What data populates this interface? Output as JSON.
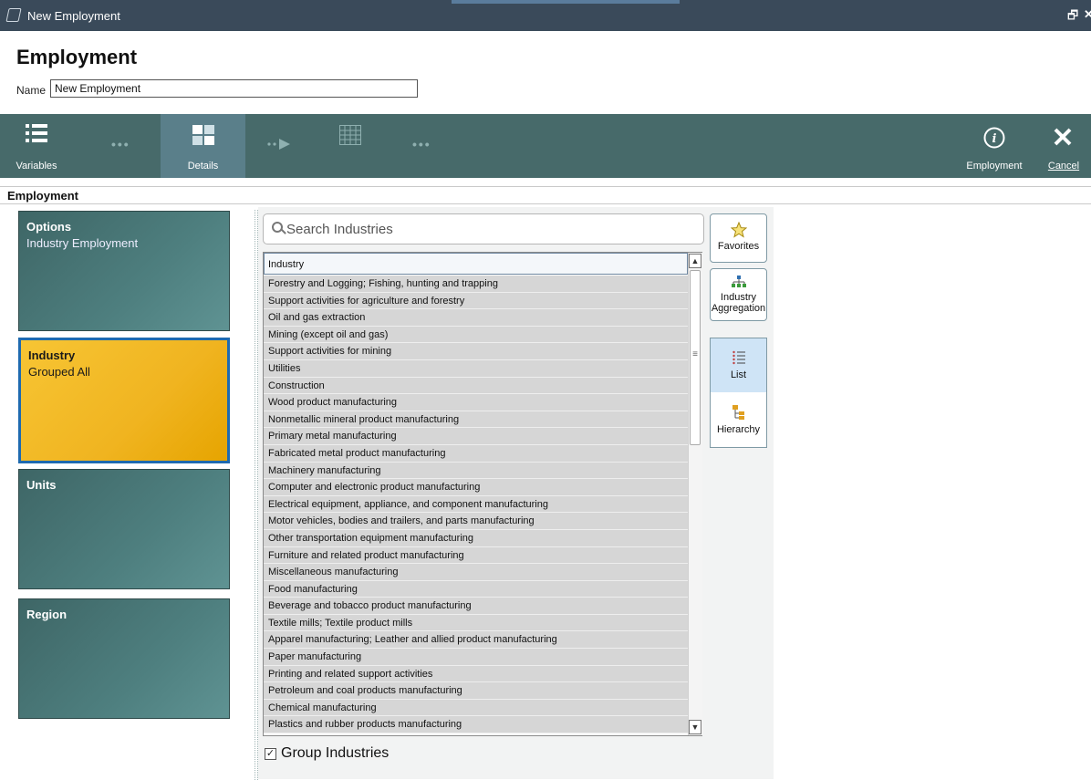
{
  "window": {
    "title": "New Employment",
    "restore_glyph": "🗗",
    "close_glyph": "✕"
  },
  "header": {
    "title": "Employment",
    "name_label": "Name",
    "name_value": "New Employment"
  },
  "toolbar": {
    "variables_label": "Variables",
    "details_label": "Details",
    "employment_label": "Employment",
    "cancel_label": "Cancel",
    "dots": "•••"
  },
  "section": {
    "title": "Employment"
  },
  "cards": [
    {
      "title": "Options",
      "subtitle": "Industry Employment"
    },
    {
      "title": "Industry",
      "subtitle": "Grouped All"
    },
    {
      "title": "Units",
      "subtitle": ""
    },
    {
      "title": "Region",
      "subtitle": ""
    }
  ],
  "search": {
    "placeholder": "Search Industries"
  },
  "list": {
    "header": "Industry",
    "scroll_grip": "≡",
    "scroll_up": "▲",
    "scroll_down": "▼",
    "rows": [
      "Forestry and Logging; Fishing, hunting and trapping",
      "Support activities for agriculture and forestry",
      "Oil and gas extraction",
      "Mining (except oil and gas)",
      "Support activities for mining",
      "Utilities",
      "Construction",
      "Wood product manufacturing",
      "Nonmetallic mineral product manufacturing",
      "Primary metal manufacturing",
      "Fabricated metal product manufacturing",
      "Machinery manufacturing",
      "Computer and electronic product manufacturing",
      "Electrical equipment, appliance, and component manufacturing",
      "Motor vehicles, bodies and trailers, and parts manufacturing",
      "Other transportation equipment manufacturing",
      "Furniture and related product manufacturing",
      "Miscellaneous manufacturing",
      "Food manufacturing",
      "Beverage and tobacco product manufacturing",
      "Textile mills; Textile product mills",
      "Apparel manufacturing; Leather and allied product manufacturing",
      "Paper manufacturing",
      "Printing and related support activities",
      "Petroleum and coal products manufacturing",
      "Chemical manufacturing",
      "Plastics and rubber products manufacturing"
    ]
  },
  "group_industries": {
    "label": "Group Industries",
    "checked": true,
    "check_glyph": "✓"
  },
  "side_buttons": {
    "favorites": "Favorites",
    "aggregation_line1": "Industry",
    "aggregation_line2": "Aggregation",
    "list": "List",
    "hierarchy": "Hierarchy"
  },
  "colors": {
    "toolbar": "#476a6a",
    "card": "#4e7f7f",
    "card_selected": "#f0b420",
    "selected_border": "#1e6ab0"
  }
}
